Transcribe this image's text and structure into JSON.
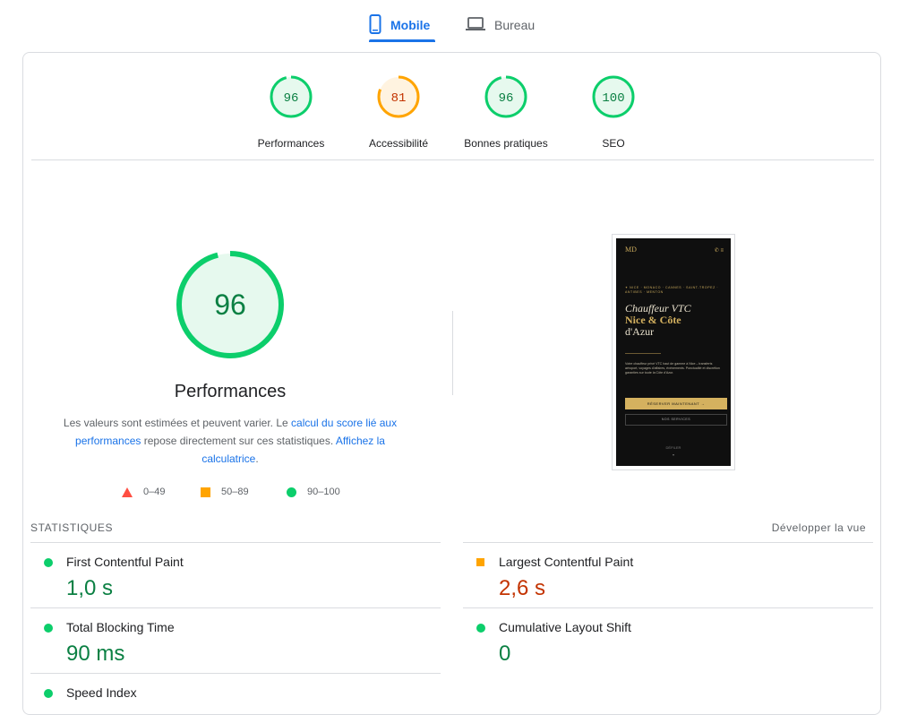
{
  "tabs": {
    "mobile_label": "Mobile",
    "desktop_label": "Bureau"
  },
  "colors": {
    "accent": "#1a73e8",
    "pass": "#0cce6b",
    "average": "#ffa400",
    "fail": "#ff4e42",
    "pass_text": "#0b8043",
    "average_text": "#c33300"
  },
  "categories": [
    {
      "score": "96",
      "label": "Performances",
      "status": "pass"
    },
    {
      "score": "81",
      "label": "Accessibilité",
      "status": "average"
    },
    {
      "score": "96",
      "label": "Bonnes pratiques",
      "status": "pass"
    },
    {
      "score": "100",
      "label": "SEO",
      "status": "pass"
    }
  ],
  "performance": {
    "score": "96",
    "title": "Performances",
    "desc_part1": "Les valeurs sont estimées et peuvent varier. Le ",
    "desc_link1": "calcul du score lié aux performances",
    "desc_part2": " repose directement sur ces statistiques. ",
    "desc_link2": "Affichez la calculatrice",
    "desc_part3": "."
  },
  "legend": {
    "fail": "0–49",
    "average": "50–89",
    "pass": "90–100"
  },
  "screenshot": {
    "logo": "MD",
    "cities": "✦ NICE · MONACO · CANNES · SAINT-TROPEZ · ANTIBES · MENTON",
    "headline_line1": "Chauffeur VTC",
    "headline_gold": "Nice & Côte",
    "headline_line3": "d'Azur",
    "paragraph": "Votre chauffeur privé VTC haut de gamme à Nice – transferts aéroport, voyages d'affaires, événements. Ponctualité et discrétion garanties sur toute la Côte d'Azur.",
    "primary_button": "RÉSERVER MAINTENANT →",
    "secondary_button": "NOS SERVICES",
    "scroll_hint": "DÉFILER"
  },
  "stats": {
    "title": "STATISTIQUES",
    "expand_label": "Développer la vue",
    "metrics": [
      {
        "name": "First Contentful Paint",
        "value": "1,0 s",
        "status": "pass"
      },
      {
        "name": "Largest Contentful Paint",
        "value": "2,6 s",
        "status": "average"
      },
      {
        "name": "Total Blocking Time",
        "value": "90 ms",
        "status": "pass"
      },
      {
        "name": "Cumulative Layout Shift",
        "value": "0",
        "status": "pass"
      },
      {
        "name": "Speed Index",
        "value": "",
        "status": "pass"
      }
    ]
  }
}
